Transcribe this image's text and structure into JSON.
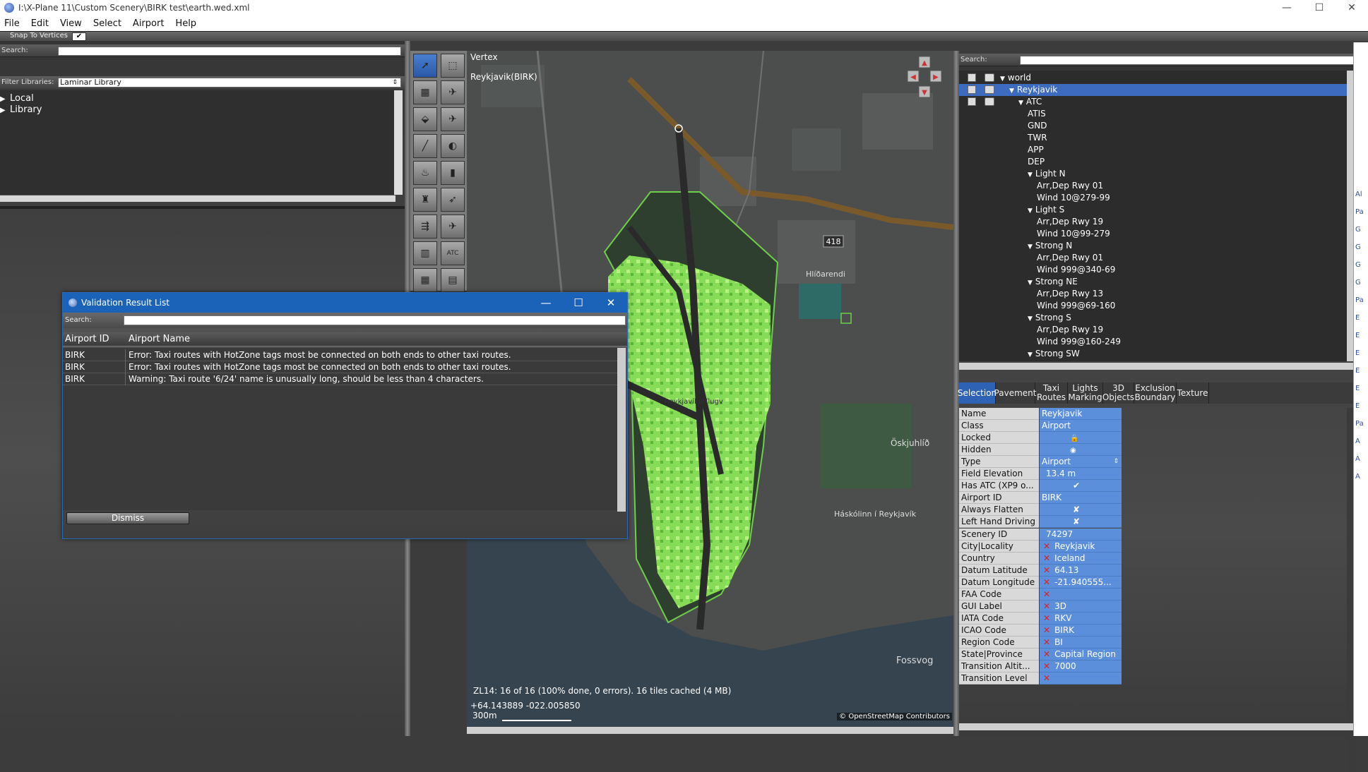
{
  "window": {
    "title": "I:\\X-Plane 11\\Custom Scenery\\BIRK test\\earth.wed.xml",
    "buttons": {
      "minimize": "—",
      "maximize": "☐",
      "close": "✕"
    }
  },
  "menu": [
    "File",
    "Edit",
    "View",
    "Select",
    "Airport",
    "Help"
  ],
  "toolbar": {
    "snap_label": "Snap To Vertices",
    "snap_checked": "✔"
  },
  "library": {
    "search_label": "Search:",
    "filter_label": "Filter Libraries:",
    "filter_value": "Laminar Library",
    "items": [
      {
        "label": "Local"
      },
      {
        "label": "Library"
      }
    ]
  },
  "map": {
    "tool_name": "Vertex",
    "airport_label": "Reykjavik(BIRK)",
    "status": "ZL14: 16 of 16 (100% done, 0 errors). 16 tiles cached (4 MB)",
    "coords": "+64.143889 -022.005850",
    "scale": "300m",
    "attribution": "© OpenStreetMap Contributors",
    "road_number": "418",
    "places": {
      "a": "Hlíðarendi",
      "b": "Öskjuhlíð",
      "c": "Háskólinn í Reykjavík",
      "d": "Fossvog",
      "e": "Reykjavíkurflugv"
    }
  },
  "tools": [
    {
      "name": "vertex-tool-icon",
      "glyph": "➚",
      "selected": true
    },
    {
      "name": "marquee-tool-icon",
      "glyph": "⬚"
    },
    {
      "name": "runway-tool-icon",
      "glyph": "▦"
    },
    {
      "name": "helipad-tool-icon",
      "glyph": "✈"
    },
    {
      "name": "sealane-tool-icon",
      "glyph": "⬙"
    },
    {
      "name": "ramp-start-tool-icon",
      "glyph": "✈"
    },
    {
      "name": "taxiline-tool-icon",
      "glyph": "╱"
    },
    {
      "name": "boundary-tool-icon",
      "glyph": "◐"
    },
    {
      "name": "light-fixture-tool-icon",
      "glyph": "♨"
    },
    {
      "name": "sign-tool-icon",
      "glyph": "▮"
    },
    {
      "name": "tower-viewpoint-tool-icon",
      "glyph": "♜"
    },
    {
      "name": "windsock-tool-icon",
      "glyph": "➶"
    },
    {
      "name": "taxi-route-tool-icon",
      "glyph": "⇶"
    },
    {
      "name": "beacon-tool-icon",
      "glyph": "✈"
    },
    {
      "name": "facade-tool-icon",
      "glyph": "▥"
    },
    {
      "name": "atc-tool-icon",
      "glyph": "ATC"
    },
    {
      "name": "forest-tool-icon",
      "glyph": "▦"
    },
    {
      "name": "object-tool-icon",
      "glyph": "▤"
    }
  ],
  "hierarchy": {
    "search_label": "Search:",
    "rows": [
      {
        "label": "world",
        "indent": 0,
        "tri": true
      },
      {
        "label": "Reykjavik",
        "indent": 1,
        "tri": true,
        "selected": true
      },
      {
        "label": "ATC",
        "indent": 2,
        "tri": true
      },
      {
        "label": "ATIS",
        "indent": 3
      },
      {
        "label": "GND",
        "indent": 3
      },
      {
        "label": "TWR",
        "indent": 3
      },
      {
        "label": "APP",
        "indent": 3
      },
      {
        "label": "DEP",
        "indent": 3
      },
      {
        "label": "Light N",
        "indent": 3,
        "tri": true
      },
      {
        "label": "Arr,Dep Rwy 01",
        "indent": 4
      },
      {
        "label": "Wind 10@279-99",
        "indent": 4
      },
      {
        "label": "Light S",
        "indent": 3,
        "tri": true
      },
      {
        "label": "Arr,Dep Rwy 19",
        "indent": 4
      },
      {
        "label": "Wind 10@99-279",
        "indent": 4
      },
      {
        "label": "Strong N",
        "indent": 3,
        "tri": true
      },
      {
        "label": "Arr,Dep Rwy 01",
        "indent": 4
      },
      {
        "label": "Wind 999@340-69",
        "indent": 4
      },
      {
        "label": "Strong NE",
        "indent": 3,
        "tri": true
      },
      {
        "label": "Arr,Dep Rwy 13",
        "indent": 4
      },
      {
        "label": "Wind 999@69-160",
        "indent": 4
      },
      {
        "label": "Strong S",
        "indent": 3,
        "tri": true
      },
      {
        "label": "Arr,Dep Rwy 19",
        "indent": 4
      },
      {
        "label": "Wind 999@160-249",
        "indent": 4
      },
      {
        "label": "Strong SW",
        "indent": 3,
        "tri": true
      }
    ]
  },
  "tabs": [
    {
      "label": "Selection",
      "active": true
    },
    {
      "label": "Pavement"
    },
    {
      "label": "Taxi Routes"
    },
    {
      "label": "Lights Marking"
    },
    {
      "label": "3D Objects"
    },
    {
      "label": "Exclusion Boundary"
    },
    {
      "label": "Texture"
    }
  ],
  "properties": [
    {
      "k": "Name",
      "v": "Reykjavik"
    },
    {
      "k": "Class",
      "v": "Airport"
    },
    {
      "k": "Locked",
      "v": "",
      "icon": "lock"
    },
    {
      "k": "Hidden",
      "v": "",
      "icon": "eye"
    },
    {
      "k": "Type",
      "v": "Airport",
      "dropdown": "⇕"
    },
    {
      "k": "Field Elevation",
      "v": "13.4 m"
    },
    {
      "k": "Has ATC (XP9 o...",
      "v": "✔"
    },
    {
      "k": "Airport ID",
      "v": "BIRK"
    },
    {
      "k": "Always Flatten",
      "v": "✘"
    },
    {
      "k": "Left Hand Driving",
      "v": "✘"
    },
    {
      "k": "Scenery ID",
      "v": "74297"
    },
    {
      "k": "City|Locality",
      "v": "Reykjavik",
      "x": true
    },
    {
      "k": "Country",
      "v": "Iceland",
      "x": true
    },
    {
      "k": "Datum Latitude",
      "v": "64.13",
      "x": true
    },
    {
      "k": "Datum Longitude",
      "v": "-21.940555...",
      "x": true
    },
    {
      "k": "FAA Code",
      "v": "",
      "x": true
    },
    {
      "k": "GUI Label",
      "v": "3D",
      "x": true
    },
    {
      "k": "IATA Code",
      "v": "RKV",
      "x": true
    },
    {
      "k": "ICAO Code",
      "v": "BIRK",
      "x": true
    },
    {
      "k": "Region Code",
      "v": "BI",
      "x": true
    },
    {
      "k": "State|Province",
      "v": "Capital Region",
      "x": true
    },
    {
      "k": "Transition Altit...",
      "v": "7000",
      "x": true
    },
    {
      "k": "Transition Level",
      "v": "",
      "x": true
    }
  ],
  "dialog": {
    "title": "Validation Result List",
    "search_label": "Search:",
    "col_id": "Airport ID",
    "col_name": "Airport Name",
    "rows": [
      {
        "id": "BIRK",
        "msg": "Error: Taxi routes with HotZone tags most be connected on both ends to other taxi routes."
      },
      {
        "id": "BIRK",
        "msg": "Error: Taxi routes with HotZone tags most be connected on both ends to other taxi routes."
      },
      {
        "id": "BIRK",
        "msg": "Warning: Taxi route '6/24' name is unusually long, should be less than 4 characters."
      }
    ],
    "dismiss": "Dismiss",
    "buttons": {
      "minimize": "—",
      "maximize": "☐",
      "close": "✕"
    }
  },
  "colors": {
    "selection": "#3c6bbf",
    "accent": "#1a63b8",
    "airport_overlay": "#8fea5a"
  }
}
